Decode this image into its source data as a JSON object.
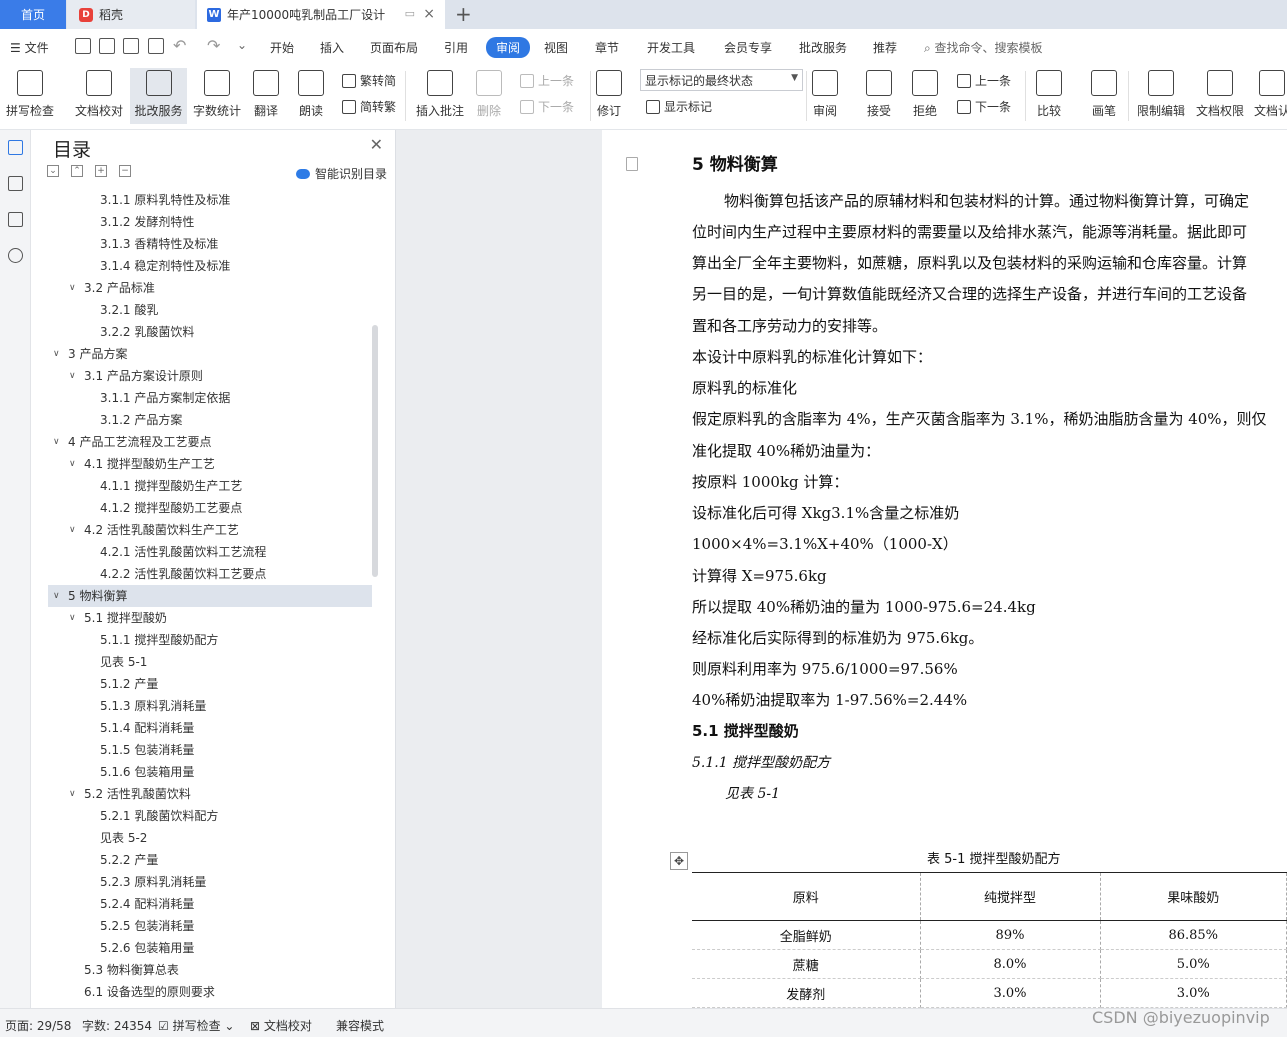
{
  "tabs": {
    "home": "首页",
    "app": "稻壳",
    "app_logo": "D",
    "doc_logo": "W",
    "document": "年产10000吨乳制品工厂设计",
    "add": "+",
    "close": "×"
  },
  "menu": {
    "file": "文件",
    "items": [
      "开始",
      "插入",
      "页面布局",
      "引用",
      "审阅",
      "视图",
      "章节",
      "开发工具",
      "会员专享",
      "批改服务",
      "推荐"
    ],
    "search": "查找命令、搜索模板"
  },
  "ribbon": {
    "spell": "拼写检查",
    "proofread": "文档校对",
    "correction": "批改服务",
    "wordcount": "字数统计",
    "translate": "翻译",
    "read_aloud": "朗读",
    "to_traditional": "繁转简",
    "to_simplified": "简转繁",
    "insert_comment": "插入批注",
    "delete": "删除",
    "prev": "上一条",
    "next": "下一条",
    "track": "修订",
    "markup_select": "显示标记的最终状态",
    "show_markup": "显示标记",
    "review": "审阅",
    "accept": "接受",
    "reject": "拒绝",
    "prev2": "上一条",
    "next2": "下一条",
    "compare": "比较",
    "pen": "画笔",
    "restrict": "限制编辑",
    "rights": "文档权限",
    "more": "文档认"
  },
  "toc": {
    "title": "目录",
    "smart": "智能识别目录",
    "items": [
      {
        "text": "3.1.1  原料乳特性及标准",
        "level": 3
      },
      {
        "text": "3.1.2  发酵剂特性",
        "level": 3
      },
      {
        "text": "3.1.3  香精特性及标准",
        "level": 3
      },
      {
        "text": "3.1.4  稳定剂特性及标准",
        "level": 3
      },
      {
        "text": "3.2  产品标准",
        "level": 2
      },
      {
        "text": "3.2.1  酸乳",
        "level": 3
      },
      {
        "text": "3.2.2  乳酸菌饮料",
        "level": 3
      },
      {
        "text": "3  产品方案",
        "level": 1
      },
      {
        "text": "3.1  产品方案设计原则",
        "level": 2
      },
      {
        "text": "3.1.1  产品方案制定依据",
        "level": 3
      },
      {
        "text": "3.1.2  产品方案",
        "level": 3
      },
      {
        "text": "4  产品工艺流程及工艺要点",
        "level": 1
      },
      {
        "text": "4.1  搅拌型酸奶生产工艺",
        "level": 2
      },
      {
        "text": "4.1.1  搅拌型酸奶生产工艺",
        "level": 3
      },
      {
        "text": "4.1.2  搅拌型酸奶工艺要点",
        "level": 3
      },
      {
        "text": "4.2  活性乳酸菌饮料生产工艺",
        "level": 2
      },
      {
        "text": "4.2.1  活性乳酸菌饮料工艺流程",
        "level": 3
      },
      {
        "text": "4.2.2  活性乳酸菌饮料工艺要点",
        "level": 3
      },
      {
        "text": "5  物料衡算",
        "level": 1
      },
      {
        "text": "5.1  搅拌型酸奶",
        "level": 2
      },
      {
        "text": "5.1.1  搅拌型酸奶配方",
        "level": 3
      },
      {
        "text": "见表 5-1",
        "level": 3
      },
      {
        "text": "5.1.2  产量",
        "level": 3
      },
      {
        "text": "5.1.3  原料乳消耗量",
        "level": 3
      },
      {
        "text": "5.1.4  配料消耗量",
        "level": 3
      },
      {
        "text": "5.1.5  包装消耗量",
        "level": 3
      },
      {
        "text": "5.1.6  包装箱用量",
        "level": 3
      },
      {
        "text": "5.2  活性乳酸菌饮料",
        "level": 2
      },
      {
        "text": "5.2.1  乳酸菌饮料配方",
        "level": 3
      },
      {
        "text": "见表 5-2",
        "level": 3
      },
      {
        "text": "5.2.2  产量",
        "level": 3
      },
      {
        "text": "5.2.3  原料乳消耗量",
        "level": 3
      },
      {
        "text": "5.2.4  配料消耗量",
        "level": 3
      },
      {
        "text": "5.2.5  包装消耗量",
        "level": 3
      },
      {
        "text": "5.2.6  包装箱用量",
        "level": 3
      },
      {
        "text": "5.3  物料衡算总表",
        "level": 2
      },
      {
        "text": "6.1  设备选型的原则要求",
        "level": 2
      }
    ]
  },
  "document": {
    "heading": "5  物料衡算",
    "lines": [
      "物料衡算包括该产品的原辅材料和包装材料的计算。通过物料衡算计算，可确定",
      "位时间内生产过程中主要原材料的需要量以及给排水蒸汽，能源等消耗量。据此即可",
      "算出全厂全年主要物料，如蔗糖，原料乳以及包装材料的采购运输和仓库容量。计算",
      "另一目的是，一旬计算数值能既经济又合理的选择生产设备，并进行车间的工艺设备",
      "置和各工序劳动力的安排等。",
      "本设计中原料乳的标准化计算如下：",
      "原料乳的标准化",
      "假定原料乳的含脂率为 4%，生产灭菌含脂率为 3.1%，稀奶油脂肪含量为 40%，则仅",
      "准化提取 40%稀奶油量为：",
      "按原料 1000kg 计算：",
      "设标准化后可得 Xkg3.1%含量之标准奶",
      "1000×4%=3.1%X+40%（1000-X）",
      "计算得 X=975.6kg",
      "所以提取 40%稀奶油的量为 1000-975.6=24.4kg",
      "经标准化后实际得到的标准奶为 975.6kg。",
      "则原料利用率为 975.6/1000=97.56%",
      "40%稀奶油提取率为 1-97.56%=2.44%"
    ],
    "sub1": "5.1  搅拌型酸奶",
    "sub2": "5.1.1  搅拌型酸奶配方",
    "see": "见表 5-1",
    "table_caption": "表 5-1  搅拌型酸奶配方",
    "table_head": [
      "原料",
      "纯搅拌型",
      "果味酸奶"
    ],
    "table_rows": [
      [
        "全脂鲜奶",
        "89%",
        "86.85%"
      ],
      [
        "蔗糖",
        "8.0%",
        "5.0%"
      ],
      [
        "发酵剂",
        "3.0%",
        "3.0%"
      ]
    ]
  },
  "status": {
    "page": "页面: 29/58",
    "words": "字数: 24354",
    "spell": "拼写检查",
    "proof": "文档校对",
    "compat": "兼容模式"
  },
  "watermark": "CSDN @biyezuopinvip",
  "colors": {
    "accent": "#2f78e3",
    "home_tab": "#3a7ce8",
    "selection": "#dde3ec"
  }
}
